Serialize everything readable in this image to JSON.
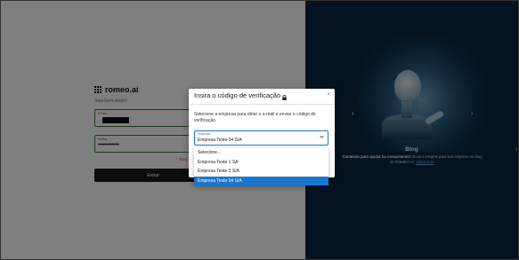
{
  "login": {
    "brand": "romeo.ai",
    "welcome": "Seja bem-vindo!",
    "email_label": "E-mail",
    "password_label": "Senha",
    "password_value": "••••••••••••",
    "forgot_link": "Esq",
    "submit_label": "Entrar"
  },
  "hero": {
    "blog_title": "Blog",
    "blog_text_bold": "Conteúdo para ajudar no crescimento!",
    "blog_text": "Dicas e insights para sua empresa no blog do ROMEO.AI.",
    "blog_link": "Saiba mais",
    "prev_arrow": "‹",
    "next_arrow": "›"
  },
  "modal": {
    "title": "Insira o código de verificação",
    "close_label": "×",
    "description": "Selecione a empresa para obter o e-mail e enviar o código de verificação.",
    "select_label": "Empresa",
    "select_value": "Empresa Teste 04 S/A",
    "options": [
      "Selecione...",
      "Empresa Teste 1 SA",
      "Empresa Teste 3 S/A",
      "Empresa Teste 04 S/A"
    ],
    "selected_index": 3
  },
  "colors": {
    "accent": "#1976d2",
    "hero_bg": "#0a2740",
    "button_bg": "#1a1a1a",
    "link_red": "#d32f2f"
  },
  "icons": {
    "lock": "lock-icon",
    "chevron": "chevron-down-icon",
    "close": "close-icon"
  }
}
